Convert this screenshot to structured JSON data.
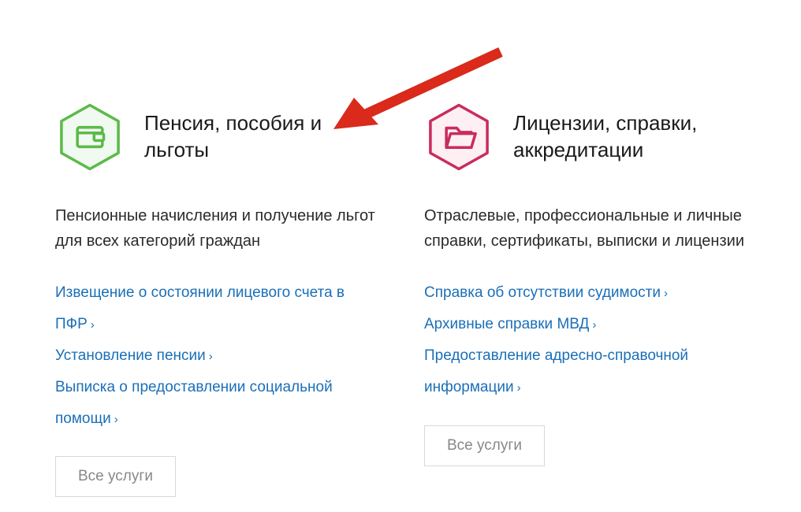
{
  "colors": {
    "green": "#5cba4a",
    "red": "#c92c5c",
    "link": "#1a6fb8",
    "arrow": "#d92a1b"
  },
  "cards": [
    {
      "title": "Пенсия, пособия и льготы",
      "description": "Пенсионные начисления и получение льгот для всех категорий граждан",
      "icon": "wallet-icon",
      "links": [
        "Извещение о состоянии лицевого счета в ПФР",
        "Установление пенсии",
        "Выписка о предоставлении социальной помощи"
      ],
      "button": "Все услуги"
    },
    {
      "title": "Лицензии, справки, аккредитации",
      "description": "Отраслевые, профессиональные и личные справки, сертификаты, выписки и лицензии",
      "icon": "folder-icon",
      "links": [
        "Справка об отсутствии судимости",
        "Архивные справки МВД",
        "Предоставление адресно-справочной информации"
      ],
      "button": "Все услуги"
    }
  ],
  "annotation": {
    "type": "arrow"
  }
}
